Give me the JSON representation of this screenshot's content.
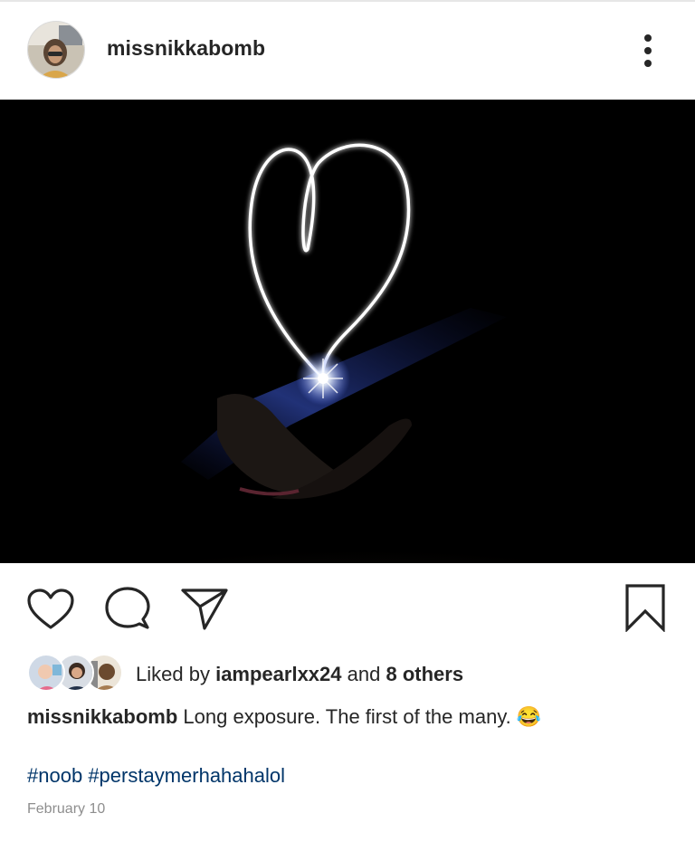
{
  "post": {
    "username": "missnikkabomb",
    "more_icon": "more-vertical-icon",
    "image_icon": "light-painting-heart",
    "likes": {
      "prefix": "Liked by",
      "liker": "iampearlxx24",
      "and": "and",
      "others": "8 others"
    },
    "caption": {
      "username": "missnikkabomb",
      "text": "Long exposure. The first of the many.",
      "emoji": "😂"
    },
    "hashtags": [
      "#noob",
      "#perstaymerhahahalol"
    ],
    "date": "February 10"
  },
  "actions": {
    "like_icon": "heart-icon",
    "comment_icon": "comment-icon",
    "share_icon": "send-icon",
    "save_icon": "bookmark-icon"
  },
  "colors": {
    "hashtag": "#003569",
    "text": "#262626",
    "muted": "#8e8e8e",
    "photo_bg": "#000000"
  }
}
